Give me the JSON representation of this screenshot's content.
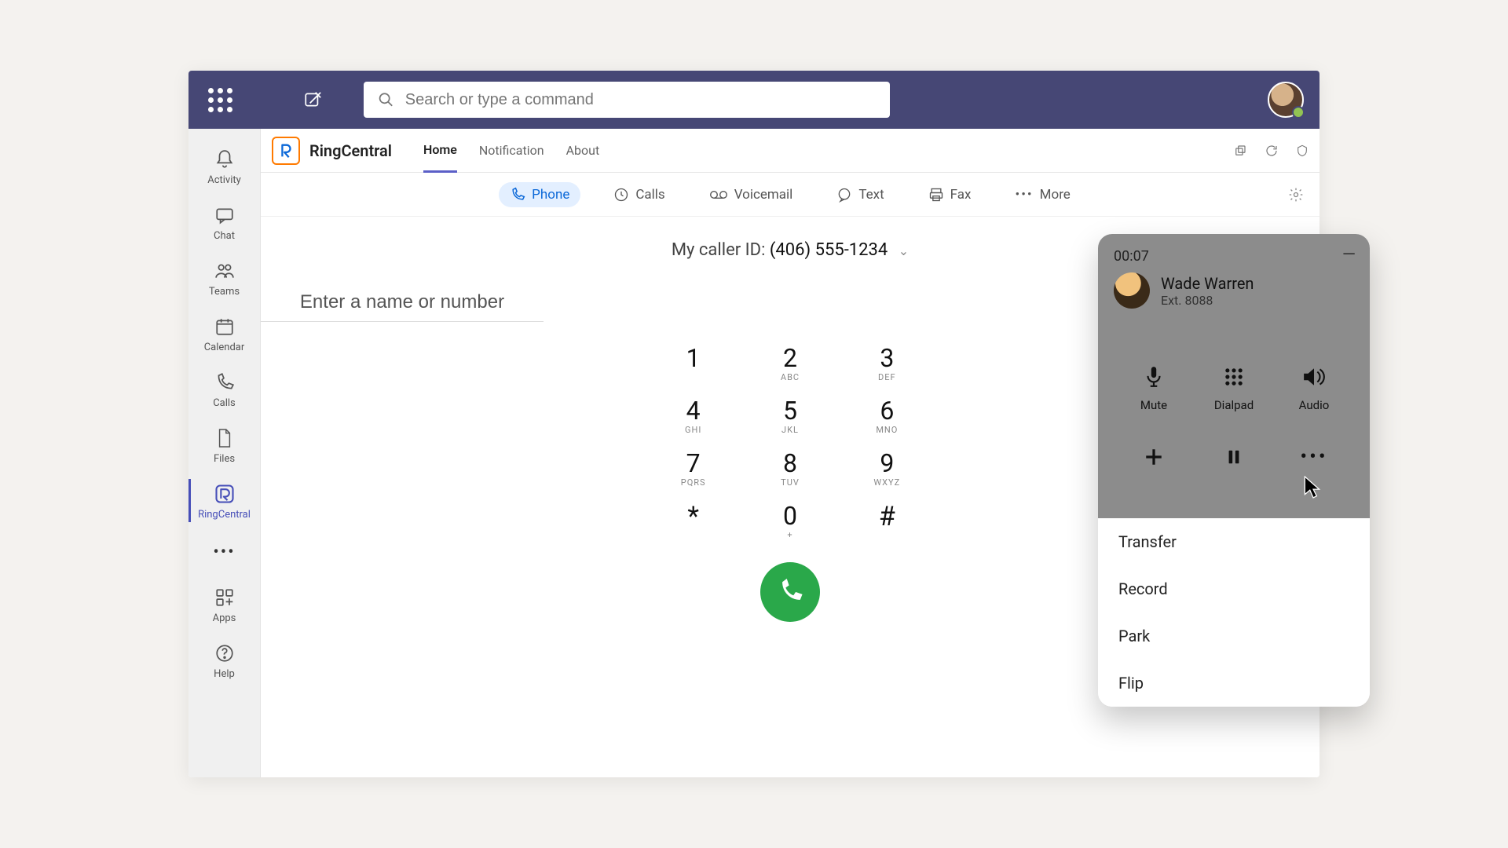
{
  "header": {
    "search_placeholder": "Search or type a command"
  },
  "rail": {
    "items": [
      {
        "label": "Activity"
      },
      {
        "label": "Chat"
      },
      {
        "label": "Teams"
      },
      {
        "label": "Calendar"
      },
      {
        "label": "Calls"
      },
      {
        "label": "Files"
      },
      {
        "label": "RingCentral"
      }
    ],
    "apps_label": "Apps",
    "help_label": "Help"
  },
  "plugin": {
    "name": "RingCentral",
    "tabs": [
      {
        "label": "Home",
        "active": true
      },
      {
        "label": "Notification",
        "active": false
      },
      {
        "label": "About",
        "active": false
      }
    ]
  },
  "subtabs": [
    {
      "label": "Phone",
      "active": true
    },
    {
      "label": "Calls"
    },
    {
      "label": "Voicemail"
    },
    {
      "label": "Text"
    },
    {
      "label": "Fax"
    },
    {
      "label": "More"
    }
  ],
  "dialer": {
    "caller_label": "My caller ID: ",
    "caller_number": "(406) 555-1234",
    "input_placeholder": "Enter a name or number",
    "keys": [
      {
        "d": "1",
        "s": ""
      },
      {
        "d": "2",
        "s": "ABC"
      },
      {
        "d": "3",
        "s": "DEF"
      },
      {
        "d": "4",
        "s": "GHI"
      },
      {
        "d": "5",
        "s": "JKL"
      },
      {
        "d": "6",
        "s": "MNO"
      },
      {
        "d": "7",
        "s": "PQRS"
      },
      {
        "d": "8",
        "s": "TUV"
      },
      {
        "d": "9",
        "s": "WXYZ"
      },
      {
        "d": "*",
        "s": ""
      },
      {
        "d": "0",
        "s": "+"
      },
      {
        "d": "#",
        "s": ""
      }
    ]
  },
  "call": {
    "timer": "00:07",
    "contact_name": "Wade Warren",
    "contact_ext": "Ext. 8088",
    "controls": [
      {
        "label": "Mute"
      },
      {
        "label": "Dialpad"
      },
      {
        "label": "Audio"
      }
    ],
    "menu": [
      {
        "label": "Transfer"
      },
      {
        "label": "Record"
      },
      {
        "label": "Park"
      },
      {
        "label": "Flip"
      }
    ]
  }
}
